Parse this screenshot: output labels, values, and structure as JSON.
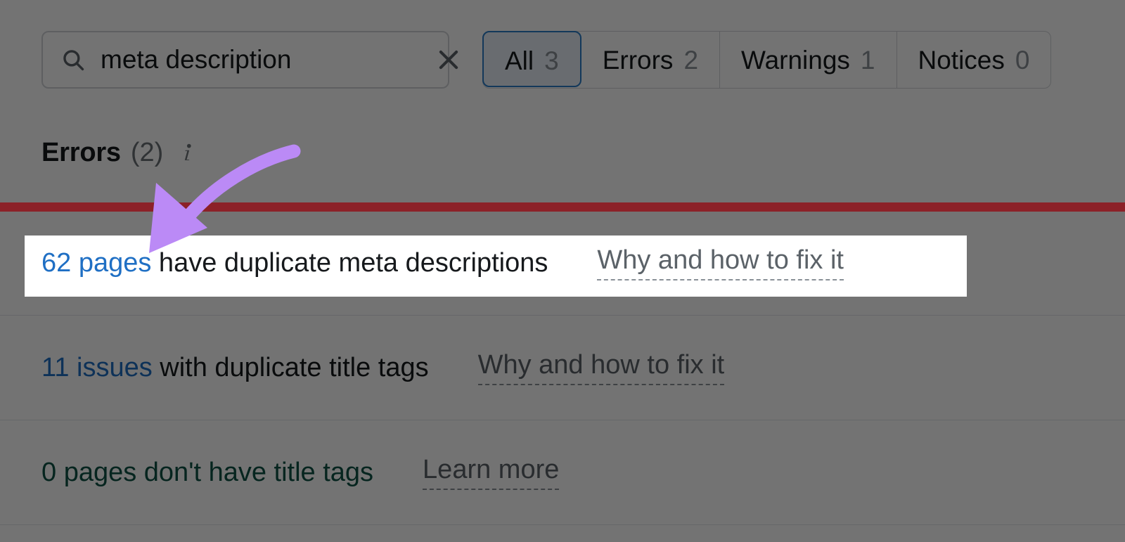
{
  "search": {
    "value": "meta description",
    "placeholder": "Search",
    "search_icon": "search-icon",
    "clear_icon": "close-icon"
  },
  "filters": {
    "tabs": [
      {
        "label": "All",
        "count": "3",
        "active": true
      },
      {
        "label": "Errors",
        "count": "2",
        "active": false
      },
      {
        "label": "Warnings",
        "count": "1",
        "active": false
      },
      {
        "label": "Notices",
        "count": "0",
        "active": false
      }
    ]
  },
  "section": {
    "title": "Errors",
    "count": "(2)",
    "info_icon": "info-icon"
  },
  "issues": [
    {
      "link_text": "62 pages",
      "rest_text": " have duplicate meta descriptions",
      "fix_label": "Why and how to fix it",
      "severity": "error",
      "highlighted": true
    },
    {
      "link_text": "11 issues",
      "rest_text": " with duplicate title tags",
      "fix_label": "Why and how to fix it",
      "severity": "error",
      "highlighted": false
    },
    {
      "link_text": "0 pages",
      "rest_text": " don't have title tags",
      "fix_label": "Learn more",
      "severity": "ok",
      "highlighted": false
    }
  ],
  "annotation": {
    "arrow_icon": "curved-arrow-icon",
    "arrow_color": "#bb8af6",
    "rule_color": "#8c2128"
  },
  "colors": {
    "link_blue": "#1f6fc4",
    "ok_green": "#0e5245",
    "accent_blue": "#2a7cc7",
    "dim_overlay": "rgba(0,0,0,0.55)"
  }
}
